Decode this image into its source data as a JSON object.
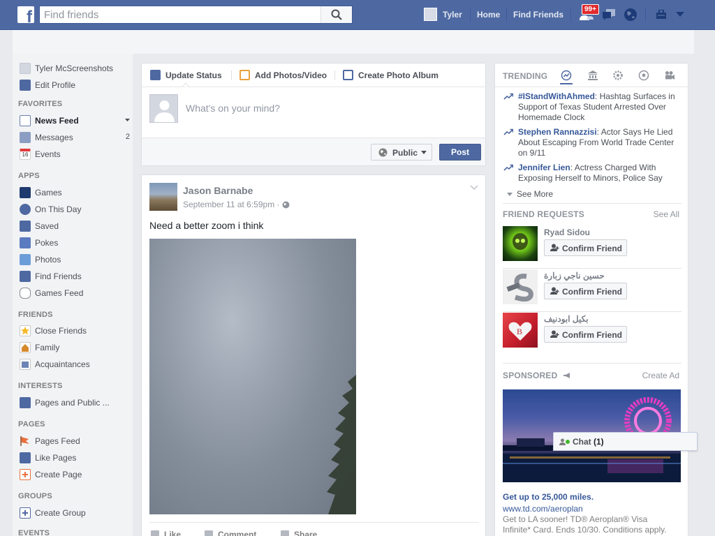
{
  "topbar": {
    "logo": "f",
    "search_placeholder": "Find friends",
    "user_name": "Tyler",
    "home_label": "Home",
    "find_friends_label": "Find Friends",
    "friend_requests_badge": "99+",
    "accent_color": "#4e69a2"
  },
  "left_nav": {
    "profile_name": "Tyler McScreenshots",
    "edit_profile": "Edit Profile",
    "sections": {
      "favorites": "FAVORITES",
      "apps": "APPS",
      "friends": "FRIENDS",
      "interests": "INTERESTS",
      "pages": "PAGES",
      "groups": "GROUPS",
      "events": "EVENTS"
    },
    "favorites": [
      {
        "label": "News Feed",
        "icon": "news-feed-icon"
      },
      {
        "label": "Messages",
        "icon": "messages-icon",
        "count": "2"
      },
      {
        "label": "Events",
        "icon": "calendar-icon",
        "icon_text": "16"
      }
    ],
    "apps": [
      {
        "label": "Games",
        "icon": "games-icon"
      },
      {
        "label": "On This Day",
        "icon": "clock-icon"
      },
      {
        "label": "Saved",
        "icon": "bookmark-icon"
      },
      {
        "label": "Pokes",
        "icon": "poke-icon"
      },
      {
        "label": "Photos",
        "icon": "photos-icon"
      },
      {
        "label": "Find Friends",
        "icon": "find-friends-icon"
      },
      {
        "label": "Games Feed",
        "icon": "gamepad-icon"
      }
    ],
    "friends": [
      {
        "label": "Close Friends",
        "icon": "star-icon"
      },
      {
        "label": "Family",
        "icon": "family-icon"
      },
      {
        "label": "Acquaintances",
        "icon": "acquaintances-icon"
      }
    ],
    "interests": [
      {
        "label": "Pages and Public ...",
        "icon": "rss-icon"
      }
    ],
    "pages": [
      {
        "label": "Pages Feed",
        "icon": "flag-icon"
      },
      {
        "label": "Like Pages",
        "icon": "thumbs-up-icon"
      },
      {
        "label": "Create Page",
        "icon": "create-page-icon"
      }
    ],
    "groups": [
      {
        "label": "Create Group",
        "icon": "create-group-icon"
      }
    ]
  },
  "composer": {
    "tab_status": "Update Status",
    "tab_photos": "Add Photos/Video",
    "tab_album": "Create Photo Album",
    "placeholder": "What's on your mind?",
    "privacy": "Public",
    "post_button": "Post"
  },
  "post": {
    "author": "Jason Barnabe",
    "timestamp": "September 11 at 6:59pm",
    "text": "Need a better zoom i think",
    "actions": [
      "Like",
      "Comment",
      "Share"
    ]
  },
  "trending": {
    "heading": "TRENDING",
    "items": [
      {
        "topic": "#IStandWithAhmed",
        "desc": ": Hashtag Surfaces in Support of Texas Student Arrested Over Homemade Clock"
      },
      {
        "topic": "Stephen Rannazzisi",
        "desc": ": Actor Says He Lied About Escaping From World Trade Center on 9/11"
      },
      {
        "topic": "Jennifer Lien",
        "desc": ": Actress Charged With Exposing Herself to Minors, Police Say"
      }
    ],
    "see_more": "See More"
  },
  "friend_requests": {
    "heading": "FRIEND REQUESTS",
    "see_all": "See All",
    "confirm_label": "Confirm Friend",
    "items": [
      {
        "name": "Ryad Sidou"
      },
      {
        "name": "حسين ناجي زبارة"
      },
      {
        "name": "بكيل ابودنيف"
      }
    ]
  },
  "sponsored": {
    "heading": "SPONSORED",
    "create_ad": "Create Ad",
    "title": "Get up to 25,000 miles.",
    "url": "www.td.com/aeroplan",
    "desc": "Get to LA sooner! TD® Aeroplan® Visa Infinite* Card. Ends 10/30. Conditions apply."
  },
  "chat": {
    "label": "Chat",
    "count": "(1)"
  }
}
